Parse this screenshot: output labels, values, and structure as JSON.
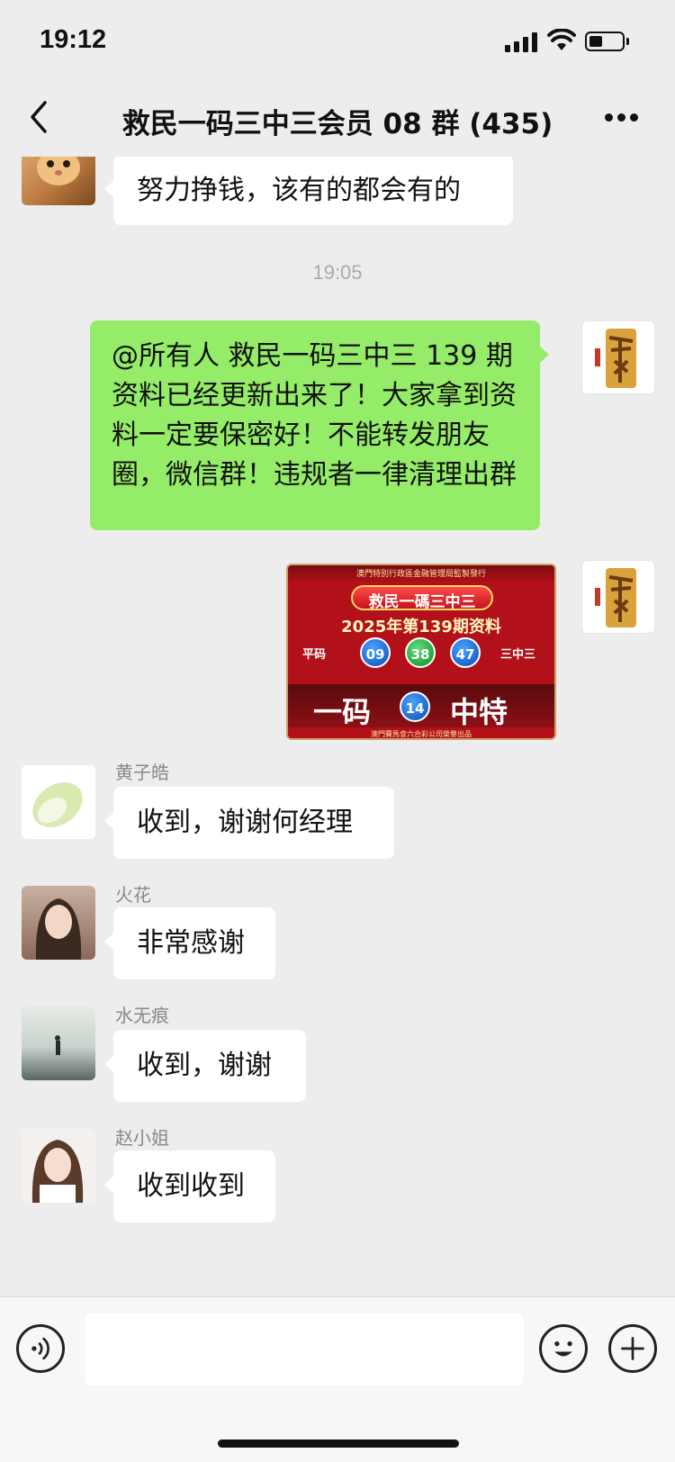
{
  "status_bar": {
    "time": "19:12"
  },
  "nav": {
    "title": "救民一码三中三会员 08 群 (435)"
  },
  "messages": {
    "m1": {
      "text": "努力挣钱，该有的都会有的"
    },
    "timestamp": "19:05",
    "m2": {
      "text": "@所有人  救民一码三中三 139 期资料已经更新出来了！大家拿到资料一定要保密好！不能转发朋友圈，微信群！违规者一律清理出群"
    },
    "m3": {
      "poster": {
        "header": "澳門特別行政區金融管理局監製發行",
        "title": "救民一碼三中三",
        "subtitle": "2025年第139期资料",
        "left_label": "平码",
        "right_label": "三中三",
        "balls": [
          "09",
          "38",
          "47"
        ],
        "big_left": "一码",
        "special_ball": "14",
        "big_right": "中特",
        "footer": "澳門賽馬會六合彩公司榮譽出品"
      }
    },
    "m4": {
      "sender": "黄子皓",
      "text": "收到，谢谢何经理"
    },
    "m5": {
      "sender": "火花",
      "text": "非常感谢"
    },
    "m6": {
      "sender": "水无痕",
      "text": "收到，谢谢"
    },
    "m7": {
      "sender": "赵小姐",
      "text": "收到收到"
    }
  },
  "colors": {
    "outgoing_bubble": "#95ec69",
    "background": "#ededed",
    "poster_red": "#b3111a"
  }
}
